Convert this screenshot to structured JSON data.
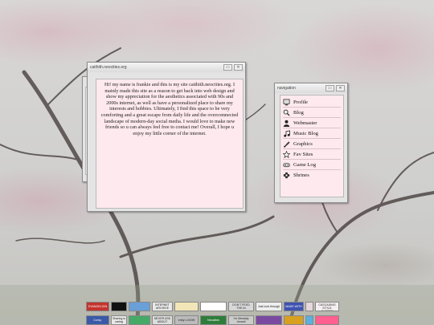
{
  "main_window": {
    "title": "caithith.neocities.org",
    "min_glyph": "▭",
    "close_glyph": "✕",
    "bio": "Hi! my name is frankie and this is my site caithith.neocities.org. I mainly made this site as a reason to get back into web design and show my appreciation for the aesthetics associated with 90s and 2000s internet, as well as have a personalized place to share my interests and hobbies. Ultimately, I find this space to be very comforting and a great escape from daily life and the overcomnected landscape of modern-day social media. I would love to make new friends so u can always feel free to contact me! Overall, I hope u enjoy my little corner of the internet."
  },
  "nav_window": {
    "title": "navigation",
    "items": [
      {
        "label": "Profile",
        "icon": "computer-icon"
      },
      {
        "label": "Blog",
        "icon": "magnifier-icon"
      },
      {
        "label": "Webmaster",
        "icon": "person-icon"
      },
      {
        "label": "Music Blog",
        "icon": "music-note-icon"
      },
      {
        "label": "Graphics",
        "icon": "paint-icon"
      },
      {
        "label": "Fav Sites",
        "icon": "star-icon"
      },
      {
        "label": "Game Log",
        "icon": "controller-icon"
      },
      {
        "label": "Shrines",
        "icon": "flower-icon"
      }
    ]
  },
  "badges_row1": [
    {
      "text": "EVANGELION",
      "color": "#c3342e"
    },
    {
      "text": "",
      "color": "#111111"
    },
    {
      "text": "",
      "color": "#6aa0d8"
    },
    {
      "text": "INTERNET ARCHIVE",
      "color": "#e8e8e8"
    },
    {
      "text": "",
      "color": "#f2e6b8"
    },
    {
      "text": "",
      "color": "#ffffff"
    },
    {
      "text": "DON'T FEED THE AI",
      "color": "#d8d8d8"
    },
    {
      "text": "Just look through",
      "color": "#eeeeee"
    },
    {
      "text": "MADE WITH",
      "color": "#3d52b0"
    },
    {
      "text": "",
      "color": "#e8d6dc"
    },
    {
      "text": "MADE WITH CASCADING STYLE SHEETS",
      "color": "#f4eef0"
    }
  ],
  "badges_row2": [
    {
      "text": "Comp.",
      "color": "#3a5aa8"
    },
    {
      "text": "Sharing is caring",
      "color": "#e8e8e8"
    },
    {
      "text": "",
      "color": "#44aa66"
    },
    {
      "text": "NEVER ASK ABOUT",
      "color": "#dddddd"
    },
    {
      "text": "enby u DGW",
      "color": "#bbbbbb"
    },
    {
      "text": "Neocities",
      "color": "#2e7d3a"
    },
    {
      "text": "I'm Mentally Unwell",
      "color": "#cccccc"
    },
    {
      "text": "",
      "color": "#7a4aa0"
    },
    {
      "text": "",
      "color": "#d8a020"
    },
    {
      "text": "",
      "color": "#5ab0e0"
    },
    {
      "text": "",
      "color": "#ff6090"
    }
  ]
}
